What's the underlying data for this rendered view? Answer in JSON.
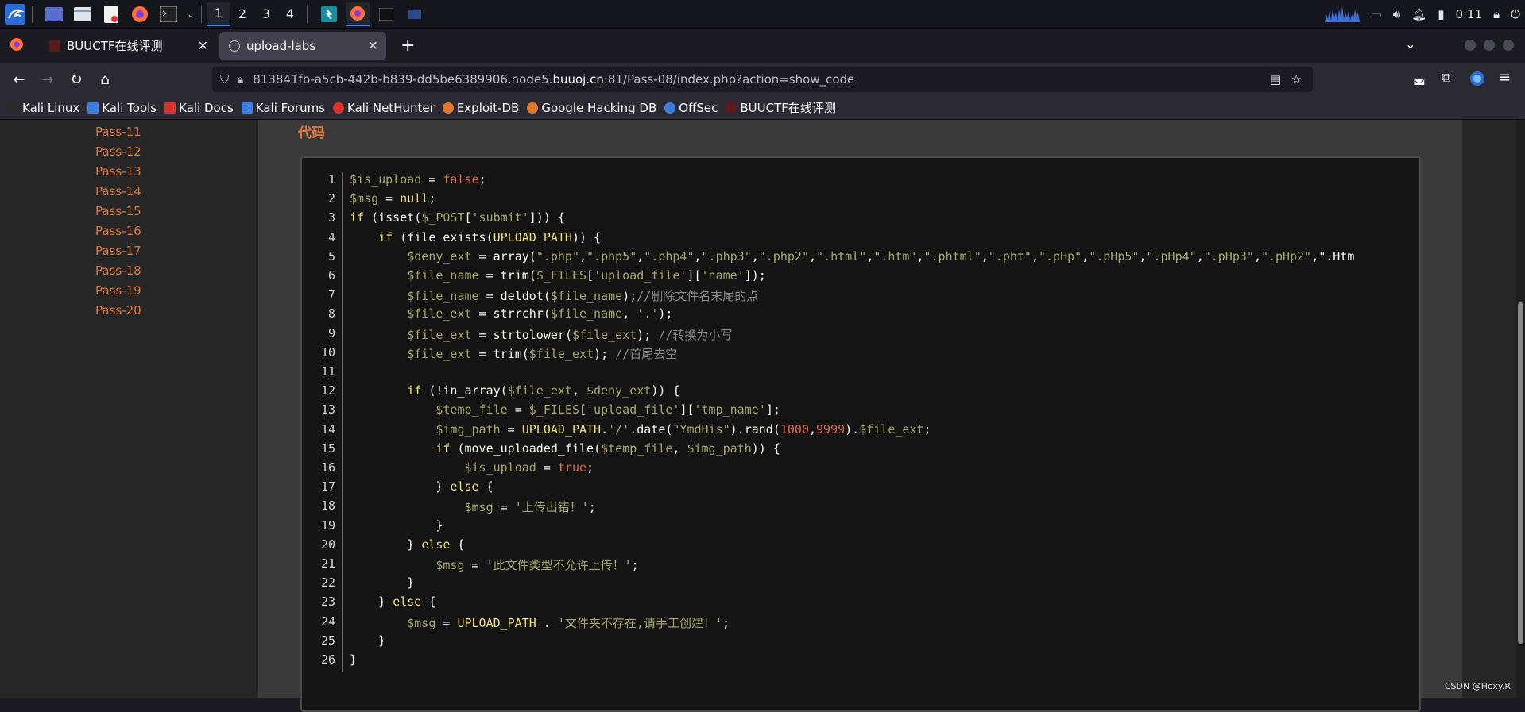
{
  "taskbar": {
    "workspaces": [
      "1",
      "2",
      "3",
      "4"
    ],
    "clock": "0:11"
  },
  "tabs": [
    {
      "title": "BUUCTF在线评测"
    },
    {
      "title": "upload-labs"
    }
  ],
  "nav": {
    "url_prefix": "813841fb-a5cb-442b-b839-dd5be6389906.node5.",
    "url_domain": "buuoj.cn",
    "url_suffix": ":81/Pass-08/index.php?action=show_code"
  },
  "bookmarks": [
    {
      "label": "Kali Linux",
      "color": "#2a6bd8"
    },
    {
      "label": "Kali Tools",
      "color": "#3a7de0"
    },
    {
      "label": "Kali Docs",
      "color": "#d9342b"
    },
    {
      "label": "Kali Forums",
      "color": "#3a7de0"
    },
    {
      "label": "Kali NetHunter",
      "color": "#d9342b"
    },
    {
      "label": "Exploit-DB",
      "color": "#e07a2a"
    },
    {
      "label": "Google Hacking DB",
      "color": "#e07a2a"
    },
    {
      "label": "OffSec",
      "color": "#3a7de0"
    },
    {
      "label": "BUUCTF在线评测",
      "color": "#c03030"
    }
  ],
  "sidebar": {
    "items": [
      "Pass-11",
      "Pass-12",
      "Pass-13",
      "Pass-14",
      "Pass-15",
      "Pass-16",
      "Pass-17",
      "Pass-18",
      "Pass-19",
      "Pass-20"
    ]
  },
  "main": {
    "section_title": "代码"
  },
  "code_lines": [
    "$is_upload = false;",
    "$msg = null;",
    "if (isset($_POST['submit'])) {",
    "    if (file_exists(UPLOAD_PATH)) {",
    "        $deny_ext = array(\".php\",\".php5\",\".php4\",\".php3\",\".php2\",\".html\",\".htm\",\".phtml\",\".pht\",\".pHp\",\".pHp5\",\".pHp4\",\".pHp3\",\".pHp2\",\".Htm",
    "        $file_name = trim($_FILES['upload_file']['name']);",
    "        $file_name = deldot($file_name);//删除文件名末尾的点",
    "        $file_ext = strrchr($file_name, '.');",
    "        $file_ext = strtolower($file_ext); //转换为小写",
    "        $file_ext = trim($file_ext); //首尾去空",
    "",
    "        if (!in_array($file_ext, $deny_ext)) {",
    "            $temp_file = $_FILES['upload_file']['tmp_name'];",
    "            $img_path = UPLOAD_PATH.'/'.date(\"YmdHis\").rand(1000,9999).$file_ext;",
    "            if (move_uploaded_file($temp_file, $img_path)) {",
    "                $is_upload = true;",
    "            } else {",
    "                $msg = '上传出错！';",
    "            }",
    "        } else {",
    "            $msg = '此文件类型不允许上传！';",
    "        }",
    "    } else {",
    "        $msg = UPLOAD_PATH . '文件夹不存在,请手工创建！';",
    "    }",
    "}"
  ],
  "watermark": "CSDN @Hoxy.R"
}
